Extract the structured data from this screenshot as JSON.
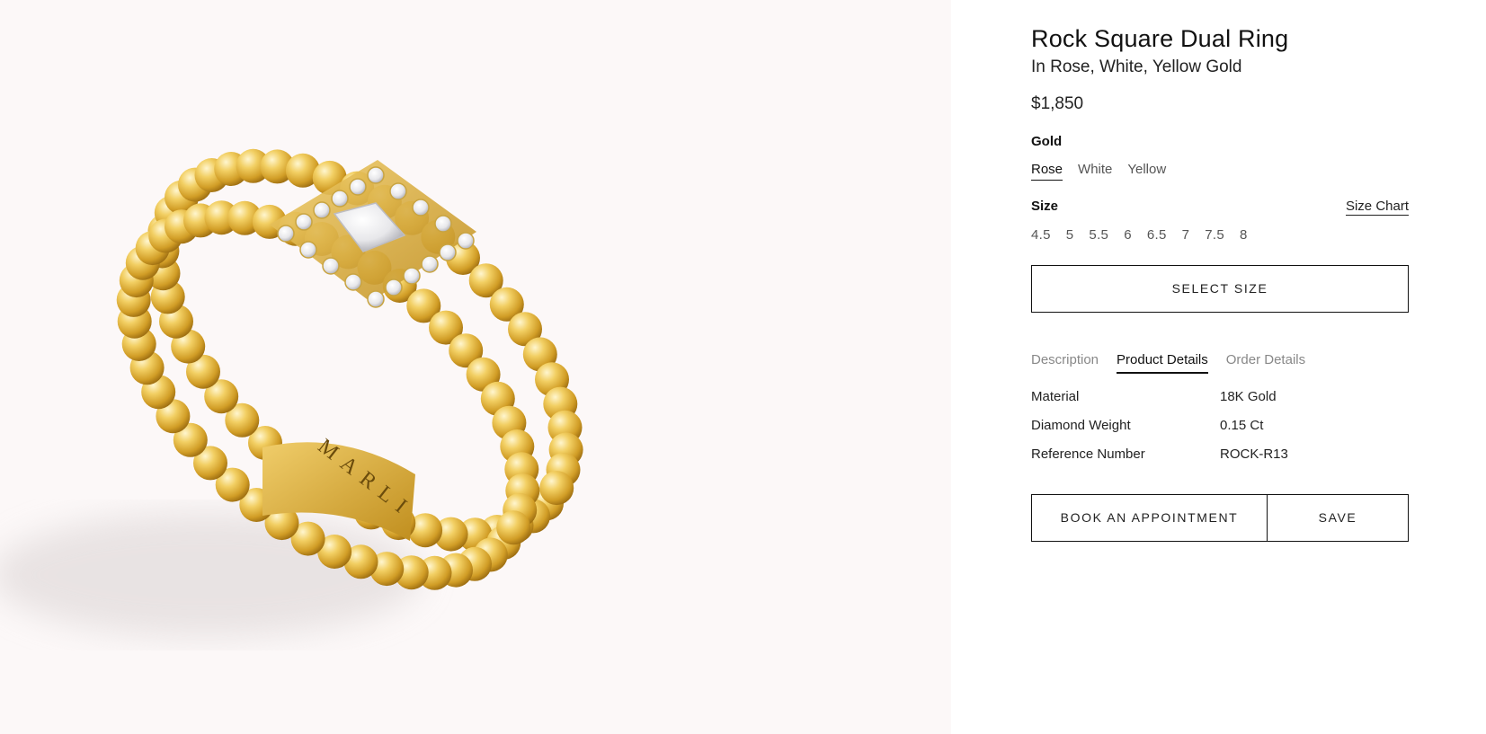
{
  "product": {
    "title": "Rock Square Dual Ring",
    "subtitle": "In Rose, White, Yellow Gold",
    "price": "$1,850",
    "engraving": "MARLI"
  },
  "gold": {
    "label": "Gold",
    "options": [
      "Rose",
      "White",
      "Yellow"
    ],
    "selected": "Rose"
  },
  "size": {
    "label": "Size",
    "chart_link": "Size Chart",
    "options": [
      "4.5",
      "5",
      "5.5",
      "6",
      "6.5",
      "7",
      "7.5",
      "8"
    ]
  },
  "select_size_button": "SELECT SIZE",
  "tabs": {
    "items": [
      "Description",
      "Product Details",
      "Order Details"
    ],
    "active": "Product Details"
  },
  "details": [
    {
      "key": "Material",
      "value": "18K Gold"
    },
    {
      "key": "Diamond Weight",
      "value": "0.15 Ct"
    },
    {
      "key": "Reference Number",
      "value": "ROCK-R13"
    }
  ],
  "actions": {
    "book": "BOOK AN APPOINTMENT",
    "save": "SAVE"
  },
  "colors": {
    "image_background": "#fcf8f8",
    "gold": "#e6b93c",
    "text": "#111111"
  }
}
